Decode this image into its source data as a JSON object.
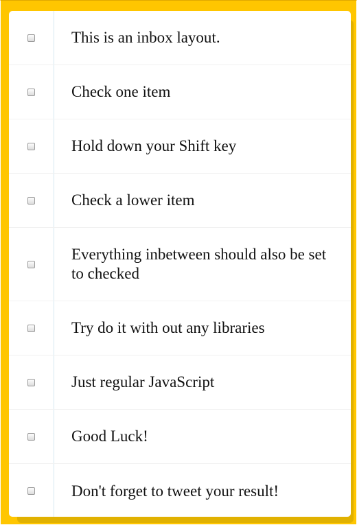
{
  "inbox": {
    "items": [
      {
        "text": "This is an inbox layout."
      },
      {
        "text": "Check one item"
      },
      {
        "text": "Hold down your Shift key"
      },
      {
        "text": "Check a lower item"
      },
      {
        "text": "Everything inbetween should also be set to checked"
      },
      {
        "text": "Try do it with out any libraries"
      },
      {
        "text": "Just regular JavaScript"
      },
      {
        "text": "Good Luck!"
      },
      {
        "text": "Don't forget to tweet your result!"
      }
    ]
  },
  "colors": {
    "background": "#ffc600",
    "panel": "#ffffff",
    "gutter_line": "#d4e8f2"
  }
}
